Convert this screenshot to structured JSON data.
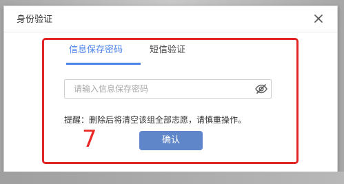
{
  "dialog": {
    "title": "身份验证"
  },
  "tabs": [
    {
      "label": "信息保存密码"
    },
    {
      "label": "短信验证"
    }
  ],
  "password_input": {
    "value": "",
    "placeholder": "请输入信息保存密码"
  },
  "reminder": "提醒：删除后将清空该组全部志愿，请慎重操作。",
  "confirm_label": "确认",
  "annotation": {
    "number": "7"
  },
  "colors": {
    "accent": "#4b84ea",
    "button": "#5f86c8",
    "annotation_red": "#e22626"
  },
  "icons": {
    "close": "close-icon",
    "password_visibility": "eye-slash-icon"
  }
}
